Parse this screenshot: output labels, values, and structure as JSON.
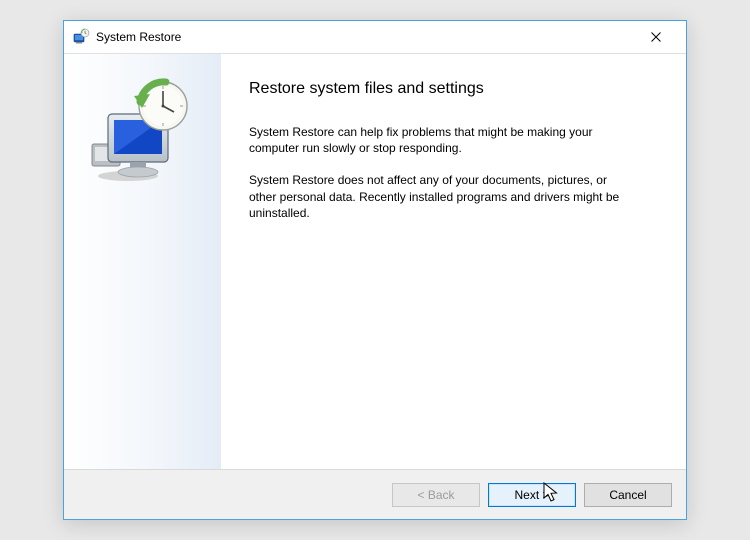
{
  "window": {
    "title": "System Restore",
    "close_label": "Close"
  },
  "page": {
    "heading": "Restore system files and settings",
    "paragraph1": "System Restore can help fix problems that might be making your computer run slowly or stop responding.",
    "paragraph2": "System Restore does not affect any of your documents, pictures, or other personal data. Recently installed programs and drivers might be uninstalled."
  },
  "buttons": {
    "back": "< Back",
    "next": "Next >",
    "cancel": "Cancel"
  },
  "icons": {
    "app": "system-restore-icon",
    "close": "close-icon",
    "graphic": "restore-computer-clock-icon"
  }
}
